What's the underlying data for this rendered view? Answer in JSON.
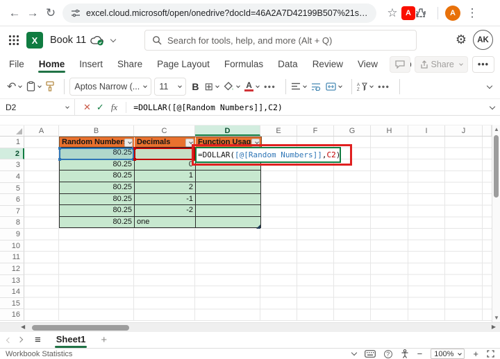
{
  "colors": {
    "accent_green": "#107C41",
    "table_header_orange": "#E9712E",
    "table_body_green": "#C7E8CF",
    "reference_blue": "#2E75B6",
    "reference_red": "#C00000",
    "annotation_red": "#E02020"
  },
  "browser": {
    "url": "excel.cloud.microsoft/open/onedrive?docId=46A2A7D42199B507%21s33bdd8...",
    "profile_initial": "A"
  },
  "app_header": {
    "workbook_title": "Book 11",
    "search_placeholder": "Search for tools, help, and more (Alt + Q)",
    "profile_initials": "AK"
  },
  "menu": {
    "tabs": [
      "File",
      "Home",
      "Insert",
      "Share",
      "Page Layout",
      "Formulas",
      "Data",
      "Review",
      "View",
      "Help"
    ],
    "active_tab": "Home",
    "share_button": "Share"
  },
  "ribbon": {
    "font_name": "Aptos Narrow (...",
    "font_size": "11",
    "bold": "B"
  },
  "formula_bar": {
    "name_box": "D2",
    "fx": "fx",
    "formula": "=DOLLAR([@[Random Numbers]],C2)"
  },
  "grid": {
    "columns": [
      "A",
      "B",
      "C",
      "D",
      "E",
      "F",
      "G",
      "H",
      "I",
      "J"
    ],
    "active_column": "D",
    "row_numbers": [
      "1",
      "2",
      "3",
      "4",
      "5",
      "6",
      "7",
      "8",
      "9",
      "10",
      "11",
      "12",
      "13",
      "14",
      "15",
      "16"
    ],
    "active_row": "2",
    "table": {
      "headers": [
        "Random Numbers",
        "Decimals",
        "Function Usage"
      ],
      "rows": [
        {
          "random_numbers": "80.25",
          "decimals": "",
          "function_usage": ""
        },
        {
          "random_numbers": "80.25",
          "decimals": "0",
          "function_usage": ""
        },
        {
          "random_numbers": "80.25",
          "decimals": "1",
          "function_usage": ""
        },
        {
          "random_numbers": "80.25",
          "decimals": "2",
          "function_usage": ""
        },
        {
          "random_numbers": "80.25",
          "decimals": "-1",
          "function_usage": ""
        },
        {
          "random_numbers": "80.25",
          "decimals": "-2",
          "function_usage": ""
        },
        {
          "random_numbers": "80.25",
          "decimals": "one",
          "function_usage": ""
        }
      ]
    },
    "edit_cell": {
      "reference": "D2",
      "part_before": "=DOLLAR(",
      "ref1": "[@[Random Numbers]]",
      "separator": ",",
      "ref2": "C2",
      "part_after": ")"
    }
  },
  "sheet_bar": {
    "active_sheet": "Sheet1"
  },
  "status_bar": {
    "left_text": "Workbook Statistics",
    "zoom_level": "100%"
  }
}
